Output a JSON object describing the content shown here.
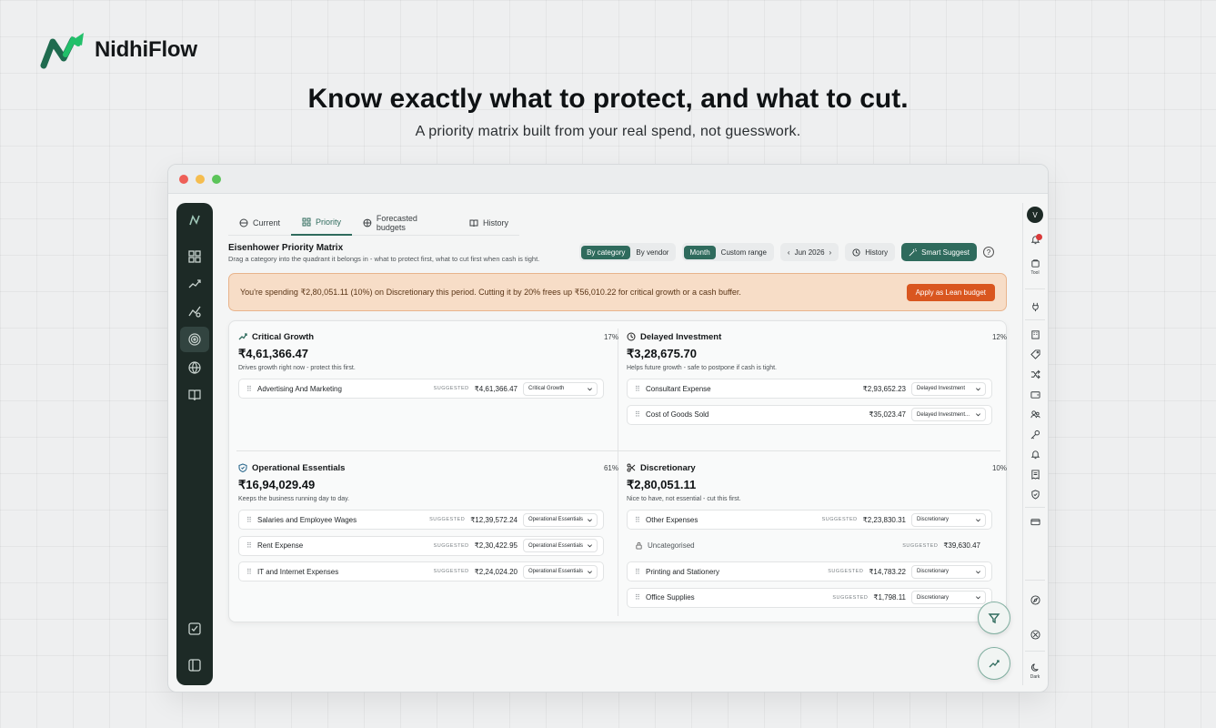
{
  "brand": {
    "name": "NidhiFlow"
  },
  "hero": {
    "headline": "Know exactly what to protect, and what to cut.",
    "subhead": "A priority matrix built from your real spend, not guesswork."
  },
  "colors": {
    "accent": "#2f6b5d",
    "rail": "#1d2a26",
    "banner_bg": "#f7ddc7",
    "banner_btn": "#d9561f"
  },
  "tabs": [
    {
      "label": "Current",
      "icon": "globe-icon"
    },
    {
      "label": "Priority",
      "icon": "grid-icon",
      "active": true
    },
    {
      "label": "Forecasted budgets",
      "icon": "globe-icon"
    },
    {
      "label": "History",
      "icon": "book-icon"
    }
  ],
  "matrix": {
    "title": "Eisenhower Priority Matrix",
    "subtitle": "Drag a category into the quadrant it belongs in - what to protect first, what to cut first when cash is tight."
  },
  "controls": {
    "view_by": [
      "By category",
      "By vendor"
    ],
    "period_mode": [
      "Month",
      "Custom range"
    ],
    "period": "Jun 2026",
    "history": "History",
    "smart_suggest": "Smart Suggest",
    "help": "?"
  },
  "banner": {
    "text": "You're spending ₹2,80,051.11 (10%) on Discretionary this period. Cutting it by 20% frees up ₹56,010.22 for critical growth or a cash buffer.",
    "button": "Apply as Lean budget"
  },
  "quadrants": {
    "critical": {
      "title": "Critical Growth",
      "percent": "17%",
      "total": "₹4,61,366.47",
      "desc": "Drives growth right now - protect this first.",
      "rows": [
        {
          "name": "Advertising And Marketing",
          "suggested": "SUGGESTED",
          "amount": "₹4,61,366.47",
          "select": "Critical Growth"
        }
      ]
    },
    "delayed": {
      "title": "Delayed Investment",
      "percent": "12%",
      "total": "₹3,28,675.70",
      "desc": "Helps future growth - safe to postpone if cash is tight.",
      "rows": [
        {
          "name": "Consultant Expense",
          "amount": "₹2,93,652.23",
          "select": "Delayed Investment"
        },
        {
          "name": "Cost of Goods Sold",
          "amount": "₹35,023.47",
          "select": "Delayed Investment..."
        }
      ]
    },
    "operational": {
      "title": "Operational Essentials",
      "percent": "61%",
      "total": "₹16,94,029.49",
      "desc": "Keeps the business running day to day.",
      "rows": [
        {
          "name": "Salaries and Employee Wages",
          "suggested": "SUGGESTED",
          "amount": "₹12,39,572.24",
          "select": "Operational Essentials"
        },
        {
          "name": "Rent Expense",
          "suggested": "SUGGESTED",
          "amount": "₹2,30,422.95",
          "select": "Operational Essentials"
        },
        {
          "name": "IT and Internet Expenses",
          "suggested": "SUGGESTED",
          "amount": "₹2,24,024.20",
          "select": "Operational Essentials"
        }
      ]
    },
    "discretionary": {
      "title": "Discretionary",
      "percent": "10%",
      "total": "₹2,80,051.11",
      "desc": "Nice to have, not essential - cut this first.",
      "rows": [
        {
          "name": "Other Expenses",
          "suggested": "SUGGESTED",
          "amount": "₹2,23,830.31",
          "select": "Discretionary"
        },
        {
          "name": "Uncategorised",
          "suggested": "SUGGESTED",
          "amount": "₹39,630.47"
        },
        {
          "name": "Printing and Stationery",
          "suggested": "SUGGESTED",
          "amount": "₹14,783.22",
          "select": "Discretionary"
        },
        {
          "name": "Office Supplies",
          "suggested": "SUGGESTED",
          "amount": "₹1,798.11",
          "select": "Discretionary"
        }
      ]
    }
  },
  "right_sidebar": {
    "avatar": "V",
    "tool_label": "Tool",
    "dark_label": "Dark"
  }
}
